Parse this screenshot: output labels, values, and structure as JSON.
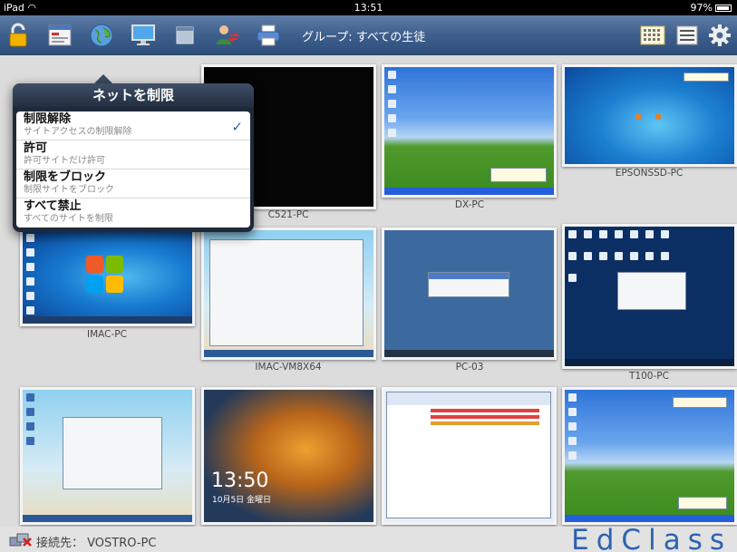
{
  "status_bar": {
    "device": "iPad",
    "time": "13:51",
    "battery": "97%"
  },
  "toolbar": {
    "group_title": "グループ: すべての生徒",
    "icons": [
      "lock-icon",
      "screen-list-icon",
      "globe-icon",
      "monitor-icon",
      "window-icon",
      "user-transfer-icon",
      "printer-icon",
      "thumbnail-grid-icon",
      "list-view-icon",
      "gear-icon"
    ]
  },
  "popover": {
    "title": "ネットを制限",
    "options": [
      {
        "title": "制限解除",
        "subtitle": "サイトアクセスの制限解除",
        "selected": true
      },
      {
        "title": "許可",
        "subtitle": "許可サイトだけ許可"
      },
      {
        "title": "制限をブロック",
        "subtitle": "制限サイトをブロック"
      },
      {
        "title": "すべて禁止",
        "subtitle": "すべてのサイトを制限"
      }
    ]
  },
  "computers": [
    {
      "name": "C521-PC",
      "screen": "black"
    },
    {
      "name": "DX-PC",
      "screen": "windows-xp"
    },
    {
      "name": "EPSONSSD-PC",
      "screen": "windows-7"
    },
    {
      "name": "IMAC-PC",
      "screen": "windows-7"
    },
    {
      "name": "IMAC-VM8X64",
      "screen": "beach-explorer"
    },
    {
      "name": "PC-03",
      "screen": "dialog"
    },
    {
      "name": "T100-PC",
      "screen": "desktop-icons"
    },
    {
      "name": "",
      "screen": "beach-window"
    },
    {
      "name": "",
      "screen": "windows-8-lock",
      "clock": "13:50",
      "date": "10月5日 金曜日"
    },
    {
      "name": "",
      "screen": "file-list"
    },
    {
      "name": "",
      "screen": "windows-xp"
    }
  ],
  "footer": {
    "connection_label": "接続先： VOSTRO-PC",
    "brand": "EdClass"
  },
  "colors": {
    "toolbar": "#3e5f8c",
    "brand": "#2b63b0",
    "check": "#2f5da8"
  }
}
